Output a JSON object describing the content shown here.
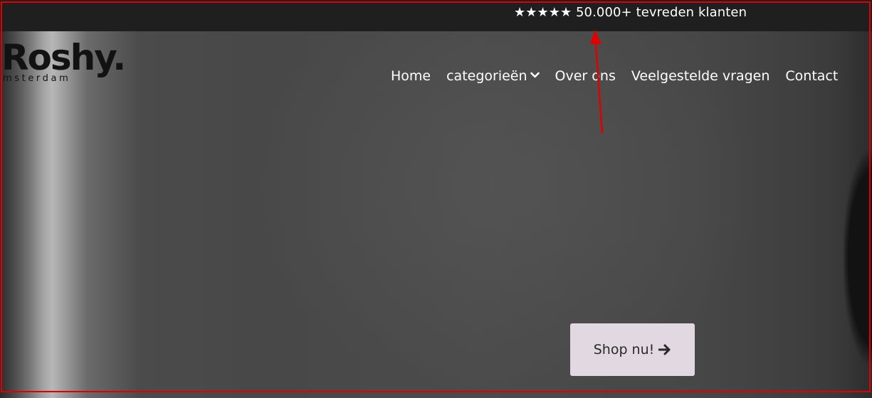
{
  "topbar": {
    "text": "★★★★★ 50.000+ tevreden klanten"
  },
  "logo": {
    "name": "Roshy.",
    "subtitle": "msterdam"
  },
  "nav": {
    "items": [
      {
        "label": "Home"
      },
      {
        "label": "categorieën"
      },
      {
        "label": "Over ons"
      },
      {
        "label": "Veelgestelde vragen"
      },
      {
        "label": "Contact"
      }
    ]
  },
  "hero": {
    "cta_label": "Shop nu!"
  },
  "colors": {
    "topbar": "#1f1f1f",
    "cta_background": "#e1d8e1",
    "annotation": "#e00000",
    "text_light": "#ffffff",
    "logo": "#121212"
  },
  "icons": {
    "dropdown": "chevron-down-icon",
    "cta": "arrow-right-icon",
    "annotation": "annotation-arrow-icon"
  }
}
